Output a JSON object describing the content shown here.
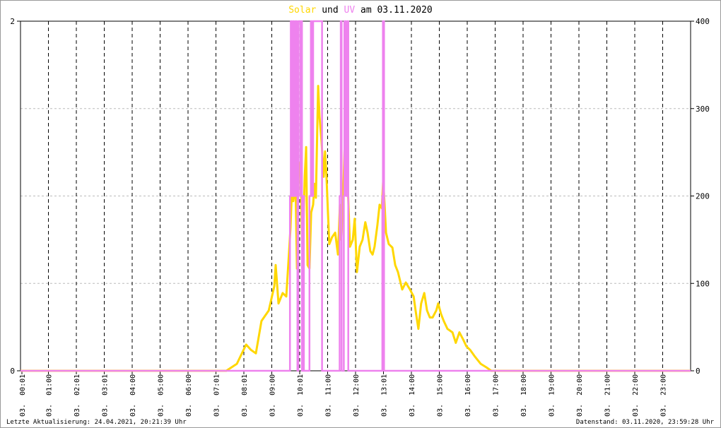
{
  "chart_data": {
    "type": "line",
    "title_parts": [
      {
        "text": "Solar",
        "color": "#ffd700"
      },
      {
        "text": " und ",
        "color": "#000000"
      },
      {
        "text": "UV",
        "color": "#ee82ee"
      },
      {
        "text": " am 03.11.2020",
        "color": "#000000"
      }
    ],
    "x_ticks": [
      "03. 00:01",
      "03. 01:00",
      "03. 02:01",
      "03. 03:01",
      "03. 04:00",
      "03. 05:00",
      "03. 06:00",
      "03. 07:01",
      "03. 08:01",
      "03. 09:00",
      "03. 10:01",
      "03. 11:00",
      "03. 12:00",
      "03. 13:01",
      "03. 14:00",
      "03. 15:00",
      "03. 16:00",
      "03. 17:00",
      "03. 18:00",
      "03. 19:00",
      "03. 20:00",
      "03. 21:00",
      "03. 22:00",
      "03. 23:00"
    ],
    "xlim_hours": [
      0,
      24
    ],
    "y_left": {
      "label": "UV",
      "ylim": [
        0,
        2
      ],
      "ticks": [
        "0",
        "2"
      ]
    },
    "y_right": {
      "label": "Solar",
      "ylim": [
        0,
        400
      ],
      "ticks": [
        "0",
        "100",
        "200",
        "300",
        "400"
      ]
    },
    "grid": true,
    "series": [
      {
        "name": "Solar",
        "axis": "right",
        "color": "#ffd700",
        "points": [
          [
            0,
            0
          ],
          [
            7.37,
            0
          ],
          [
            7.75,
            8
          ],
          [
            8.08,
            30
          ],
          [
            8.25,
            24
          ],
          [
            8.43,
            20
          ],
          [
            8.63,
            57
          ],
          [
            8.89,
            69
          ],
          [
            9.09,
            97
          ],
          [
            9.14,
            121
          ],
          [
            9.24,
            77
          ],
          [
            9.39,
            89
          ],
          [
            9.52,
            85
          ],
          [
            9.62,
            137
          ],
          [
            9.67,
            164
          ],
          [
            9.72,
            206
          ],
          [
            9.77,
            194
          ],
          [
            9.85,
            214
          ],
          [
            9.9,
            117
          ],
          [
            9.95,
            226
          ],
          [
            10.0,
            238
          ],
          [
            10.05,
            206
          ],
          [
            10.1,
            126
          ],
          [
            10.18,
            222
          ],
          [
            10.23,
            256
          ],
          [
            10.28,
            121
          ],
          [
            10.35,
            117
          ],
          [
            10.41,
            181
          ],
          [
            10.48,
            190
          ],
          [
            10.53,
            214
          ],
          [
            10.58,
            198
          ],
          [
            10.63,
            279
          ],
          [
            10.66,
            326
          ],
          [
            10.71,
            291
          ],
          [
            10.78,
            263
          ],
          [
            10.86,
            222
          ],
          [
            10.91,
            251
          ],
          [
            10.96,
            222
          ],
          [
            11.01,
            182
          ],
          [
            11.06,
            145
          ],
          [
            11.16,
            153
          ],
          [
            11.27,
            158
          ],
          [
            11.37,
            133
          ],
          [
            11.44,
            190
          ],
          [
            11.49,
            150
          ],
          [
            11.57,
            214
          ],
          [
            11.62,
            267
          ],
          [
            11.67,
            326
          ],
          [
            11.72,
            214
          ],
          [
            11.8,
            142
          ],
          [
            11.9,
            150
          ],
          [
            11.97,
            174
          ],
          [
            12.05,
            113
          ],
          [
            12.15,
            142
          ],
          [
            12.25,
            150
          ],
          [
            12.35,
            170
          ],
          [
            12.43,
            158
          ],
          [
            12.53,
            137
          ],
          [
            12.61,
            133
          ],
          [
            12.68,
            142
          ],
          [
            12.78,
            166
          ],
          [
            12.86,
            190
          ],
          [
            12.94,
            186
          ],
          [
            12.99,
            218
          ],
          [
            13.04,
            190
          ],
          [
            13.09,
            158
          ],
          [
            13.19,
            145
          ],
          [
            13.32,
            141
          ],
          [
            13.42,
            121
          ],
          [
            13.52,
            113
          ],
          [
            13.67,
            93
          ],
          [
            13.8,
            101
          ],
          [
            13.95,
            93
          ],
          [
            14.08,
            85
          ],
          [
            14.15,
            69
          ],
          [
            14.25,
            48
          ],
          [
            14.35,
            77
          ],
          [
            14.46,
            89
          ],
          [
            14.56,
            69
          ],
          [
            14.66,
            61
          ],
          [
            14.76,
            61
          ],
          [
            14.89,
            69
          ],
          [
            14.96,
            77
          ],
          [
            15.06,
            65
          ],
          [
            15.16,
            57
          ],
          [
            15.29,
            48
          ],
          [
            15.47,
            44
          ],
          [
            15.59,
            32
          ],
          [
            15.72,
            44
          ],
          [
            15.85,
            36
          ],
          [
            15.97,
            28
          ],
          [
            16.1,
            24
          ],
          [
            16.28,
            16
          ],
          [
            16.48,
            8
          ],
          [
            16.68,
            4
          ],
          [
            16.86,
            0
          ],
          [
            24,
            0
          ]
        ]
      },
      {
        "name": "UV",
        "axis": "left",
        "color": "#ee82ee",
        "step": true,
        "points": [
          [
            0,
            0
          ],
          [
            9.65,
            1
          ],
          [
            9.68,
            2
          ],
          [
            9.72,
            1
          ],
          [
            9.76,
            2
          ],
          [
            9.8,
            1
          ],
          [
            9.84,
            2
          ],
          [
            9.9,
            1
          ],
          [
            9.92,
            0
          ],
          [
            9.95,
            2
          ],
          [
            10.02,
            1
          ],
          [
            10.05,
            2
          ],
          [
            10.08,
            0
          ],
          [
            10.13,
            1
          ],
          [
            10.15,
            0
          ],
          [
            10.35,
            1
          ],
          [
            10.4,
            2
          ],
          [
            10.44,
            1
          ],
          [
            10.48,
            2
          ],
          [
            10.8,
            0
          ],
          [
            11.43,
            1
          ],
          [
            11.47,
            2
          ],
          [
            11.5,
            0
          ],
          [
            11.58,
            1
          ],
          [
            11.6,
            2
          ],
          [
            11.66,
            1
          ],
          [
            11.7,
            2
          ],
          [
            11.74,
            0
          ],
          [
            12.96,
            1
          ],
          [
            12.98,
            2
          ],
          [
            13.02,
            0
          ],
          [
            24,
            0
          ]
        ]
      }
    ]
  },
  "footer": {
    "left": "Letzte Aktualisierung: 24.04.2021, 20:21:39 Uhr",
    "right": "Datenstand: 03.11.2020, 23:59:28 Uhr"
  }
}
